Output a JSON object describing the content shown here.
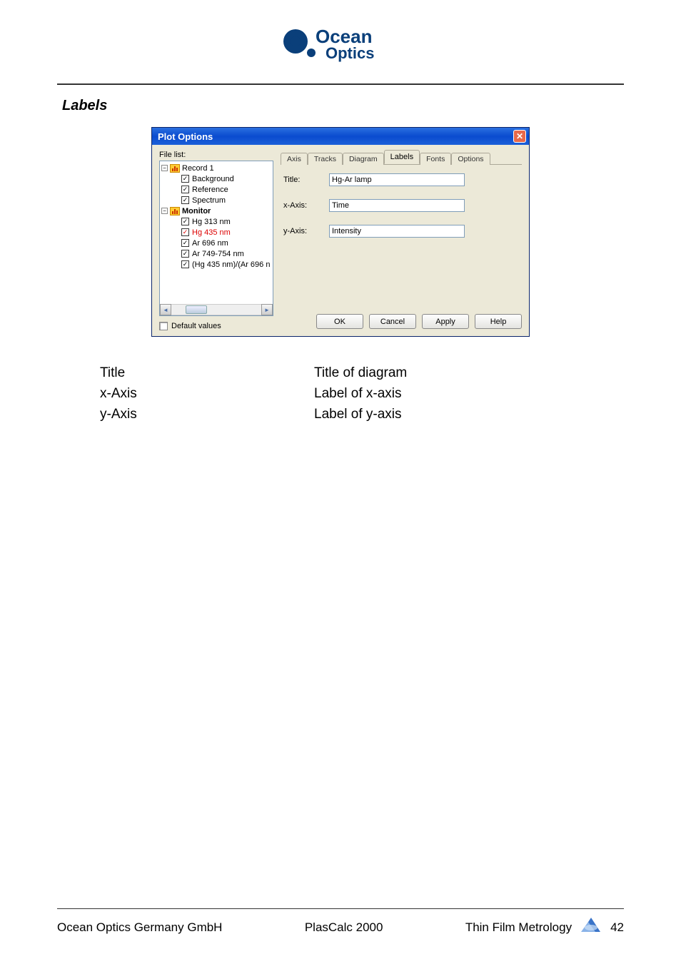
{
  "header": {
    "logo_top": "Ocean",
    "logo_bottom": "Optics"
  },
  "section_title": "Labels",
  "dialog": {
    "title": "Plot Options",
    "file_list_label": "File list:",
    "tree": {
      "record1": {
        "label": "Record 1"
      },
      "background": {
        "label": "Background"
      },
      "reference": {
        "label": "Reference"
      },
      "spectrum": {
        "label": "Spectrum"
      },
      "monitor": {
        "label": "Monitor"
      },
      "hg313": {
        "label": "Hg 313 nm"
      },
      "hg435": {
        "label": "Hg 435 nm"
      },
      "ar696": {
        "label": "Ar 696 nm"
      },
      "ar749": {
        "label": "Ar 749-754 nm"
      },
      "ratio": {
        "label": "(Hg 435 nm)/(Ar 696 n"
      }
    },
    "default_values_label": "Default values",
    "tabs": {
      "axis": "Axis",
      "tracks": "Tracks",
      "diagram": "Diagram",
      "labels": "Labels",
      "fonts": "Fonts",
      "options": "Options"
    },
    "form": {
      "title_label": "Title:",
      "title_value": "Hg-Ar lamp",
      "x_label": "x-Axis:",
      "x_value": "Time",
      "y_label": "y-Axis:",
      "y_value": "Intensity"
    },
    "buttons": {
      "ok": "OK",
      "cancel": "Cancel",
      "apply": "Apply",
      "help": "Help"
    }
  },
  "description": {
    "r1k": "Title",
    "r1v": "Title of diagram",
    "r2k": "x-Axis",
    "r2v": "Label of x-axis",
    "r3k": "y-Axis",
    "r3v": "Label of y-axis"
  },
  "footer": {
    "left": "Ocean Optics Germany GmbH",
    "center": "PlasCalc 2000",
    "right": "Thin Film Metrology",
    "page": "42"
  }
}
